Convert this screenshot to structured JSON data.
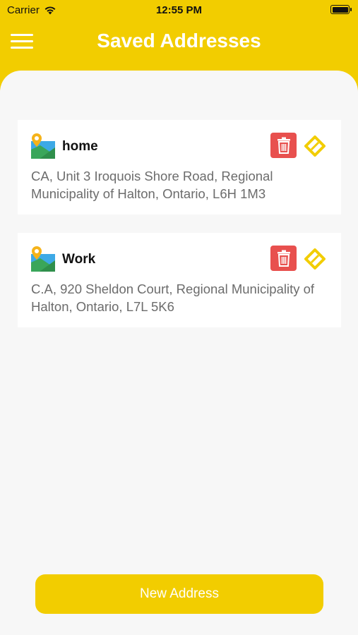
{
  "status_bar": {
    "carrier": "Carrier",
    "time": "12:55 PM",
    "icons": [
      "wifi-icon",
      "battery-icon"
    ]
  },
  "header": {
    "title": "Saved Addresses",
    "menu_icon": "hamburger-menu-icon"
  },
  "addresses": [
    {
      "name": "home",
      "address": "CA, Unit 3 Iroquois Shore Road, Regional Municipality of Halton, Ontario, L6H 1M3",
      "icons": [
        "map-pin-icon",
        "trash-icon",
        "edit-tag-icon"
      ]
    },
    {
      "name": "Work",
      "address": "C.A, 920 Sheldon Court, Regional Municipality of Halton, Ontario, L7L 5K6",
      "icons": [
        "map-pin-icon",
        "trash-icon",
        "edit-tag-icon"
      ]
    }
  ],
  "footer": {
    "new_address_label": "New Address"
  },
  "colors": {
    "brand_yellow": "#f2cd00",
    "delete_red": "#e8504e",
    "background": "#f7f7f7",
    "address_text": "#6c6c6c"
  }
}
